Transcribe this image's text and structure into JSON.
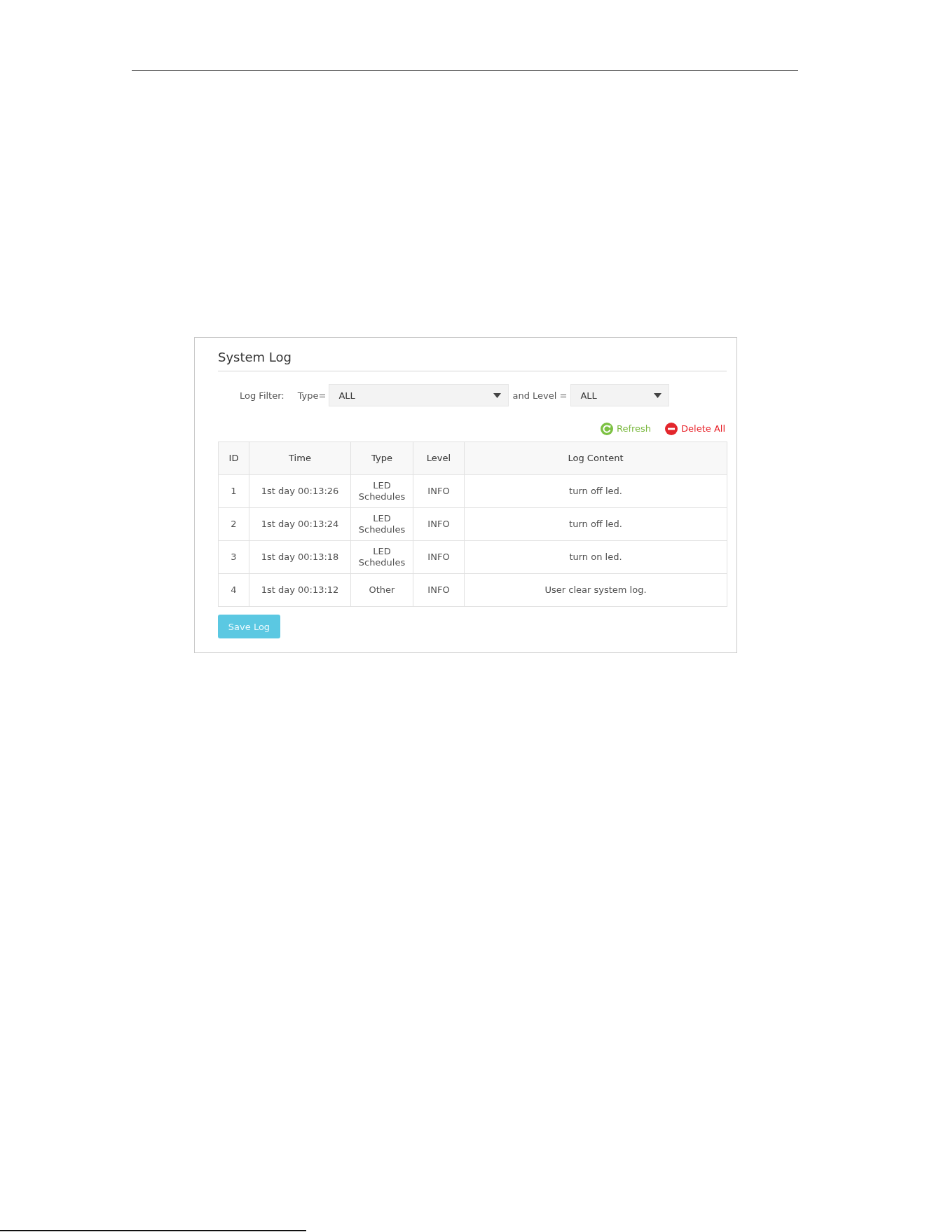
{
  "panel": {
    "title": "System Log",
    "filter": {
      "label": "Log Filter:",
      "type_label": "Type=",
      "type_value": "ALL",
      "level_label": "and Level =",
      "level_value": "ALL"
    },
    "actions": [
      {
        "kind": "refresh",
        "label": "Refresh"
      },
      {
        "kind": "delete",
        "label": "Delete All"
      }
    ],
    "table": {
      "columns": [
        "ID",
        "Time",
        "Type",
        "Level",
        "Log Content"
      ],
      "rows": [
        [
          "1",
          "1st day 00:13:26",
          "LED Schedules",
          "INFO",
          "turn off led."
        ],
        [
          "2",
          "1st day 00:13:24",
          "LED Schedules",
          "INFO",
          "turn off led."
        ],
        [
          "3",
          "1st day 00:13:18",
          "LED Schedules",
          "INFO",
          "turn on led."
        ],
        [
          "4",
          "1st day 00:13:12",
          "Other",
          "INFO",
          "User clear system log."
        ]
      ]
    },
    "save_button": "Save Log"
  }
}
